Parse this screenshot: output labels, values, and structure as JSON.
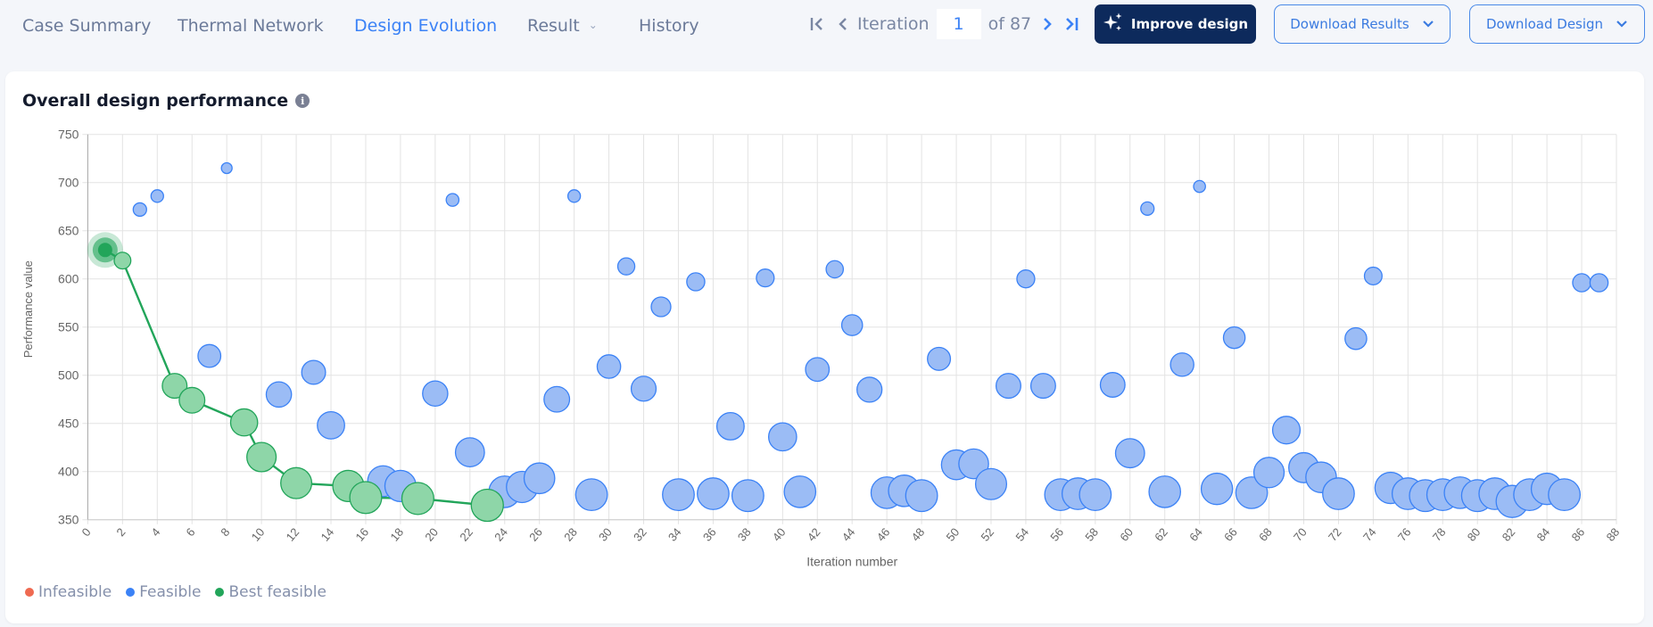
{
  "tabs": [
    {
      "label": "Case Summary",
      "active": false
    },
    {
      "label": "Thermal Network",
      "active": false
    },
    {
      "label": "Design Evolution",
      "active": true
    },
    {
      "label": "Result",
      "active": false,
      "has_dropdown": true
    },
    {
      "label": "History",
      "active": false
    }
  ],
  "iteration_nav": {
    "label": "Iteration",
    "current": "1",
    "of_label": "of 87",
    "icons": [
      "first-page-icon",
      "prev-icon",
      "next-icon",
      "last-page-icon"
    ]
  },
  "actions": {
    "improve_label": "Improve design",
    "improve_icon": "sparkles-icon",
    "download_results_label": "Download Results",
    "download_design_label": "Download Design"
  },
  "card": {
    "title": "Overall design performance",
    "info_icon": "info-icon"
  },
  "legend": [
    {
      "label": "Infeasible",
      "color": "#ef6a51"
    },
    {
      "label": "Feasible",
      "color": "#3b82f6"
    },
    {
      "label": "Best feasible",
      "color": "#22a55a"
    }
  ],
  "colors": {
    "feasible_fill": "#9bbcf5",
    "feasible_stroke": "#3b82f6",
    "best_fill": "#8ed6a8",
    "best_stroke": "#22a55a",
    "best_line": "#22a55a",
    "selected": "#22a55a",
    "active_tab": "#3b82f6",
    "primary_button": "#0d2a5c"
  },
  "chart_data": {
    "type": "scatter",
    "title": "Overall design performance",
    "xlabel": "Iteration number",
    "ylabel": "Performance value",
    "xlim": [
      0,
      88
    ],
    "ylim": [
      350,
      750
    ],
    "xticks": [
      0,
      2,
      4,
      6,
      8,
      10,
      12,
      14,
      16,
      18,
      20,
      22,
      24,
      26,
      28,
      30,
      32,
      34,
      36,
      38,
      40,
      42,
      44,
      46,
      48,
      50,
      52,
      54,
      56,
      58,
      60,
      62,
      64,
      66,
      68,
      70,
      72,
      74,
      76,
      78,
      80,
      82,
      84,
      86,
      88
    ],
    "yticks": [
      350,
      400,
      450,
      500,
      550,
      600,
      650,
      700,
      750
    ],
    "grid": true,
    "legend_position": "bottom-left",
    "selected_iteration": 1,
    "series": [
      {
        "name": "Feasible",
        "points": [
          [
            3,
            672
          ],
          [
            4,
            686
          ],
          [
            7,
            520
          ],
          [
            8,
            715
          ],
          [
            11,
            480
          ],
          [
            13,
            503
          ],
          [
            14,
            448
          ],
          [
            17,
            390
          ],
          [
            18,
            385
          ],
          [
            20,
            481
          ],
          [
            21,
            682
          ],
          [
            22,
            420
          ],
          [
            24,
            379
          ],
          [
            25,
            384
          ],
          [
            26,
            393
          ],
          [
            27,
            475
          ],
          [
            28,
            686
          ],
          [
            29,
            376
          ],
          [
            30,
            509
          ],
          [
            31,
            613
          ],
          [
            32,
            486
          ],
          [
            33,
            571
          ],
          [
            34,
            376
          ],
          [
            35,
            597
          ],
          [
            36,
            377
          ],
          [
            37,
            447
          ],
          [
            38,
            375
          ],
          [
            39,
            601
          ],
          [
            40,
            436
          ],
          [
            41,
            379
          ],
          [
            42,
            506
          ],
          [
            43,
            610
          ],
          [
            44,
            552
          ],
          [
            45,
            485
          ],
          [
            46,
            378
          ],
          [
            47,
            380
          ],
          [
            48,
            375
          ],
          [
            49,
            517
          ],
          [
            50,
            407
          ],
          [
            51,
            408
          ],
          [
            52,
            387
          ],
          [
            53,
            489
          ],
          [
            54,
            600
          ],
          [
            55,
            489
          ],
          [
            56,
            376
          ],
          [
            57,
            377
          ],
          [
            58,
            376
          ],
          [
            59,
            490
          ],
          [
            60,
            419
          ],
          [
            61,
            673
          ],
          [
            62,
            379
          ],
          [
            63,
            511
          ],
          [
            64,
            696
          ],
          [
            65,
            382
          ],
          [
            66,
            539
          ],
          [
            67,
            378
          ],
          [
            68,
            399
          ],
          [
            69,
            443
          ],
          [
            70,
            404
          ],
          [
            71,
            394
          ],
          [
            72,
            377
          ],
          [
            73,
            538
          ],
          [
            74,
            603
          ],
          [
            75,
            383
          ],
          [
            76,
            377
          ],
          [
            77,
            375
          ],
          [
            78,
            376
          ],
          [
            79,
            378
          ],
          [
            80,
            375
          ],
          [
            81,
            377
          ],
          [
            82,
            369
          ],
          [
            83,
            376
          ],
          [
            84,
            382
          ],
          [
            85,
            376
          ],
          [
            86,
            596
          ],
          [
            87,
            596
          ]
        ]
      },
      {
        "name": "Best feasible",
        "points": [
          [
            1,
            630
          ],
          [
            2,
            619
          ],
          [
            5,
            489
          ],
          [
            6,
            474
          ],
          [
            9,
            451
          ],
          [
            10,
            415
          ],
          [
            12,
            388
          ],
          [
            15,
            385
          ],
          [
            16,
            373
          ],
          [
            19,
            372
          ],
          [
            23,
            365
          ]
        ]
      },
      {
        "name": "Infeasible",
        "points": []
      }
    ]
  }
}
